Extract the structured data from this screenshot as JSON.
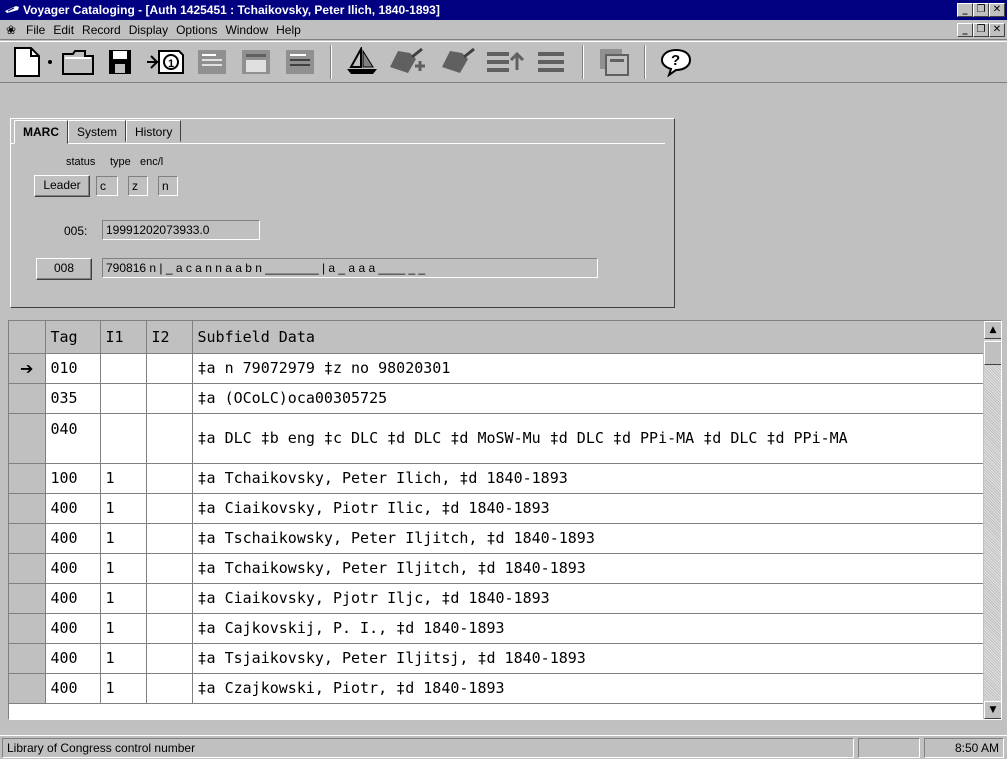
{
  "window": {
    "title": "Voyager Cataloging - [Auth 1425451 : Tchaikovsky, Peter Ilich, 1840-1893]",
    "title_bg": "#000080"
  },
  "menu": {
    "items": [
      "File",
      "Edit",
      "Record",
      "Display",
      "Options",
      "Window",
      "Help"
    ]
  },
  "toolbar": {
    "icons": [
      "new-record-icon",
      "open-folder-icon",
      "save-disk-icon",
      "retrieve-icon",
      "import-icon",
      "export-icon",
      "boat-icon",
      "pointing-hand-add-icon",
      "pointing-hand-icon",
      "list-add-icon",
      "list-icon",
      "templates-icon",
      "help-icon"
    ]
  },
  "tabs": {
    "marc": "MARC",
    "system": "System",
    "history": "History"
  },
  "leader": {
    "button_label": "Leader",
    "status_label": "status",
    "type_label": "type",
    "enc_label": "enc/l",
    "status_value": "c",
    "type_value": "z",
    "enc_value": "n"
  },
  "f005": {
    "label": "005:",
    "value": "19991202073933.0"
  },
  "f008": {
    "button_label": "008",
    "value": "790816 n | _ a c a n n a a b n ________ | a _ a a a ____ _ _"
  },
  "grid": {
    "headers": {
      "tag": "Tag",
      "i1": "I1",
      "i2": "I2",
      "data": "Subfield Data"
    },
    "rows": [
      {
        "tag": "010",
        "i1": "",
        "i2": "",
        "data": "‡a n  79072979  ‡z no 98020301",
        "selected": true
      },
      {
        "tag": "035",
        "i1": "",
        "i2": "",
        "data": "‡a (OCoLC)oca00305725"
      },
      {
        "tag": "040",
        "i1": "",
        "i2": "",
        "data": "‡a DLC ‡b eng ‡c DLC ‡d DLC ‡d MoSW-Mu ‡d DLC ‡d PPi-MA ‡d DLC ‡d PPi-MA"
      },
      {
        "tag": "100",
        "i1": "1",
        "i2": "",
        "data": "‡a Tchaikovsky, Peter Ilich, ‡d 1840-1893"
      },
      {
        "tag": "400",
        "i1": "1",
        "i2": "",
        "data": "‡a Ciaikovsky, Piotr Ilic, ‡d 1840-1893"
      },
      {
        "tag": "400",
        "i1": "1",
        "i2": "",
        "data": "‡a Tschaikowsky, Peter Iljitch, ‡d 1840-1893"
      },
      {
        "tag": "400",
        "i1": "1",
        "i2": "",
        "data": "‡a Tchaikowsky, Peter Iljitch, ‡d 1840-1893"
      },
      {
        "tag": "400",
        "i1": "1",
        "i2": "",
        "data": "‡a Ciaikovsky, Pjotr Iljc, ‡d 1840-1893"
      },
      {
        "tag": "400",
        "i1": "1",
        "i2": "",
        "data": "‡a Cajkovskij, P. I., ‡d 1840-1893"
      },
      {
        "tag": "400",
        "i1": "1",
        "i2": "",
        "data": "‡a Tsjaikovsky, Peter Iljitsj, ‡d 1840-1893"
      },
      {
        "tag": "400",
        "i1": "1",
        "i2": "",
        "data": "‡a Czajkowski, Piotr, ‡d 1840-1893"
      }
    ]
  },
  "status": {
    "message": "Library of Congress control number",
    "time": "8:50 AM"
  }
}
